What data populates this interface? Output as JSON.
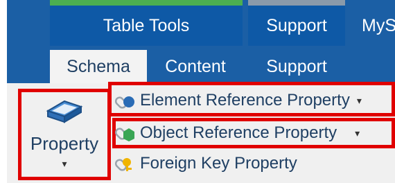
{
  "context_groups": [
    {
      "label": "Table Tools",
      "strip_color": "#4caf50"
    },
    {
      "label": "Support",
      "strip_color": "#8a9aaa"
    },
    {
      "label": "MyS",
      "strip_color": ""
    }
  ],
  "tabs": [
    {
      "label": "Schema",
      "selected": true
    },
    {
      "label": "Content",
      "selected": false
    },
    {
      "label": "Support",
      "selected": false
    }
  ],
  "ribbon": {
    "property_button": {
      "label": "Property",
      "dropdown_glyph": "▾",
      "icon": "eraser-block-icon"
    },
    "items": [
      {
        "label": "Element Reference Property",
        "icon": "element-reference-icon",
        "has_dropdown": true,
        "dropdown_glyph": "▾"
      },
      {
        "label": "Object Reference Property",
        "icon": "object-reference-icon",
        "has_dropdown": true,
        "dropdown_glyph": "▾"
      },
      {
        "label": "Foreign Key Property",
        "icon": "foreign-key-icon",
        "has_dropdown": false
      }
    ]
  },
  "colors": {
    "ribbon_blue": "#1b5fa5",
    "highlight_red": "#e00000",
    "text_dark_blue": "#1f3f63"
  }
}
